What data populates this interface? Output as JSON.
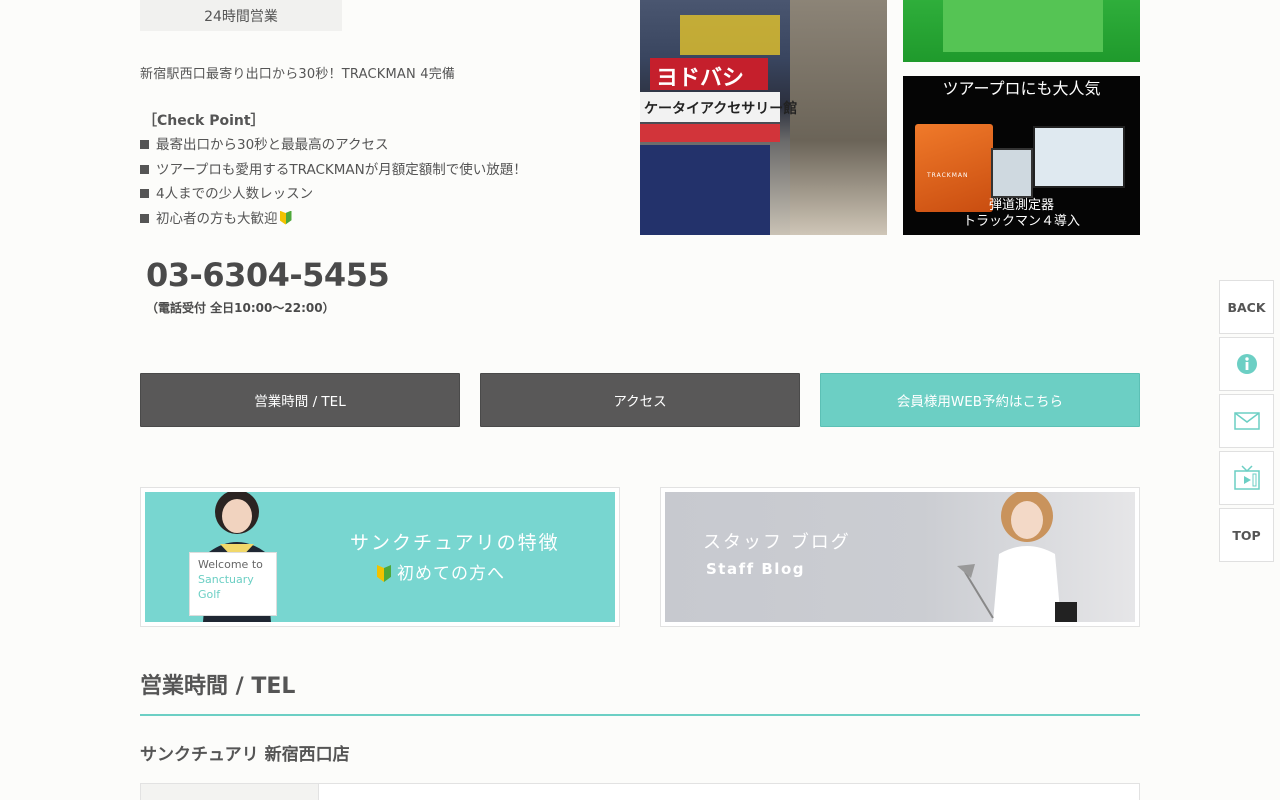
{
  "header": {
    "hours_badge": "24時間営業",
    "tagline": "新宿駅西口最寄り出口から30秒！TRACKMAN 4完備"
  },
  "checkpoint": {
    "title": "［Check Point］",
    "items": [
      "最寄出口から30秒と最最高のアクセス",
      "ツアープロも愛用するTRACKMANが月額定額制で使い放題！",
      "4人までの少人数レッスン",
      "初心者の方も大歓迎"
    ]
  },
  "contact": {
    "phone": "03-6304-5455",
    "phone_note": "（電話受付 全日10:00～22:00）"
  },
  "photos": {
    "store_sign_main": "ヨドバシ",
    "store_sign_sub": "ケータイアクセサリー館",
    "trackman_top": "ツアープロにも大人気",
    "trackman_device": "TRACKMAN",
    "trackman_bottom_1": "弾道測定器",
    "trackman_bottom_2": "トラックマン４導入"
  },
  "buttons": {
    "hours_tel": "営業時間 / TEL",
    "access": "アクセス",
    "web_reserve": "会員様用WEB予約はこちら"
  },
  "banners": {
    "feature_title": "サンクチュアリの特徴",
    "feature_sub": "初めての方へ",
    "welcome_1": "Welcome to",
    "welcome_2": "Sanctuary",
    "welcome_3": "Golf",
    "blog_title": "スタッフ ブログ",
    "blog_sub": "Staff Blog"
  },
  "section": {
    "title": "営業時間 / TEL",
    "shop_name": "サンクチュアリ 新宿西口店"
  },
  "side_nav": {
    "back": "BACK",
    "top": "TOP"
  },
  "colors": {
    "accent": "#6ccfc4",
    "dark_button": "#595858",
    "text": "#555555"
  }
}
